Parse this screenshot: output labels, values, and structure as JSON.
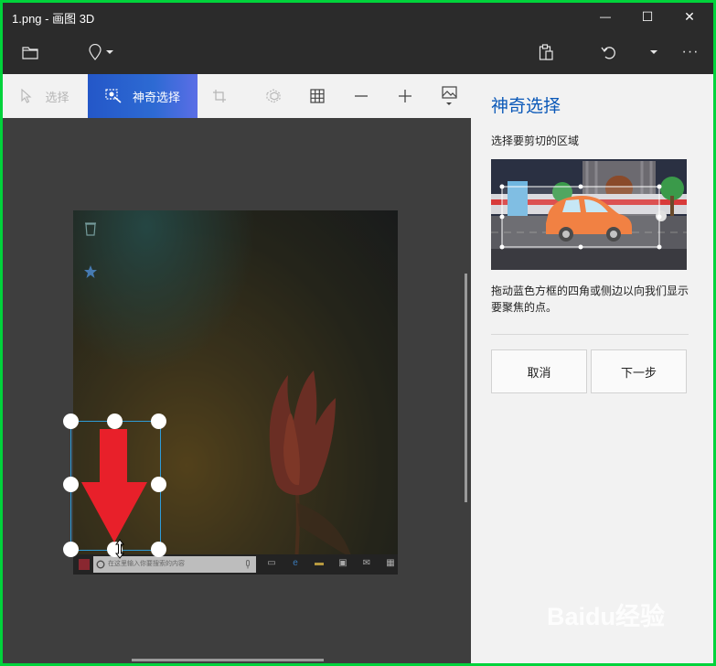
{
  "window": {
    "title": "1.png - 画图 3D",
    "controls": {
      "minimize": "—",
      "maximize": "☐",
      "close": "✕"
    }
  },
  "appbar": {
    "icons": [
      "folder-icon",
      "pin-icon",
      "chevron-down-icon",
      "paste-icon",
      "undo-icon",
      "chevron-down-icon",
      "more-icon"
    ],
    "more_label": "···"
  },
  "toolbar": {
    "select_label": "选择",
    "magic_select_label": "神奇选择",
    "tools": [
      "crop-icon",
      "3d-select-icon",
      "grid-icon",
      "minus-icon",
      "plus-icon",
      "image-icon"
    ]
  },
  "panel": {
    "title": "神奇选择",
    "step": "选择要剪切的区域",
    "description": "拖动蓝色方框的四角或侧边以向我们显示要聚焦的点。",
    "cancel_label": "取消",
    "next_label": "下一步"
  },
  "canvas": {
    "taskbar_search_placeholder": "在这里输入你要搜索的内容"
  },
  "watermark": {
    "text": "Baidu经验"
  },
  "colors": {
    "accent": "#2d6ad3",
    "panel_title": "#0a58b8",
    "selection_border": "#2e9bd6",
    "arrow": "#e8202a"
  }
}
